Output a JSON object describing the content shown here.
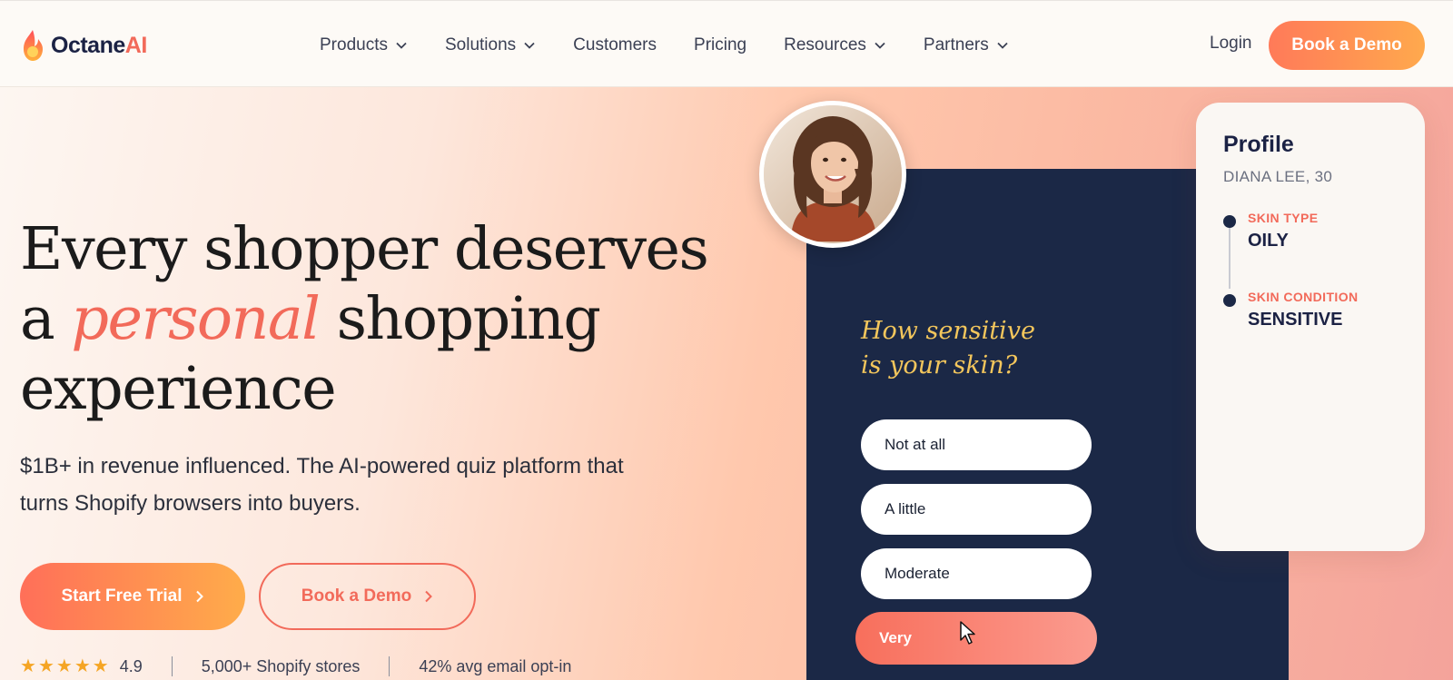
{
  "brand": {
    "name_part1": "Octane",
    "name_part2": "AI"
  },
  "nav": {
    "items": [
      {
        "label": "Products",
        "dropdown": true
      },
      {
        "label": "Solutions",
        "dropdown": true
      },
      {
        "label": "Customers",
        "dropdown": false
      },
      {
        "label": "Pricing",
        "dropdown": false
      },
      {
        "label": "Resources",
        "dropdown": true
      },
      {
        "label": "Partners",
        "dropdown": true
      }
    ],
    "login_label": "Login",
    "cta_label": "Book a Demo"
  },
  "hero": {
    "headline_part1": "Every shopper deserves a ",
    "headline_accent": "personal",
    "headline_part2": " shopping experience",
    "subhead": "$1B+ in revenue influenced. The AI-powered quiz platform that turns Shopify browsers into buyers.",
    "primary_cta": "Start Free Trial",
    "secondary_cta": "Book a Demo",
    "stats": {
      "rating": "4.9",
      "stars": 5,
      "stores": "5,000+ Shopify stores",
      "optin": "42% avg email opt-in"
    }
  },
  "quiz": {
    "question_line1": "How sensitive",
    "question_line2": "is your skin?",
    "options": [
      "Not at all",
      "A little",
      "Moderate",
      "Very"
    ],
    "selected_index": 3
  },
  "profile": {
    "title": "Profile",
    "name": "DIANA LEE, 30",
    "traits": [
      {
        "label": "SKIN TYPE",
        "value": "OILY"
      },
      {
        "label": "SKIN CONDITION",
        "value": "SENSITIVE"
      }
    ]
  },
  "colors": {
    "accent": "#f26a5a",
    "navy": "#1b2846",
    "gold": "#f3c65c",
    "cta_gradient_start": "#ff6f59",
    "cta_gradient_end": "#ffac4a"
  }
}
